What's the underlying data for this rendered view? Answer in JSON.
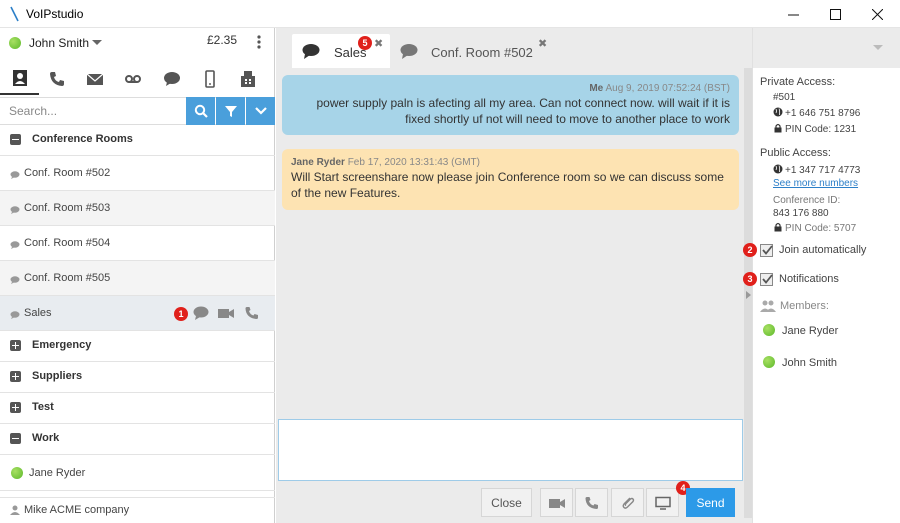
{
  "window": {
    "title": "VoIPstudio"
  },
  "user": {
    "name": "John Smith",
    "balance": "£2.35"
  },
  "search": {
    "placeholder": "Search..."
  },
  "contacts": {
    "group_conference": "Conference Rooms",
    "rooms": [
      "Conf. Room #502",
      "Conf. Room #503",
      "Conf. Room #504",
      "Conf. Room #505",
      "Sales"
    ],
    "group_emergency": "Emergency",
    "group_suppliers": "Suppliers",
    "group_test": "Test",
    "group_work": "Work",
    "work_member": "Jane Ryder",
    "footer": "Mike ACME company"
  },
  "markers": {
    "m1": "1",
    "m2": "2",
    "m3": "3",
    "m4": "4",
    "m5": "5"
  },
  "chat": {
    "tabs": [
      {
        "label": "Sales"
      },
      {
        "label": "Conf. Room #502"
      }
    ],
    "close_glyph": "✖",
    "messages": [
      {
        "sender": "Me",
        "time": "Aug 9, 2019 07:52:24 (BST)",
        "text": "power supply paln is afecting all my area. Can not connect now. will wait if it is fixed shortly uf not will need to move to another place to work"
      },
      {
        "sender": "Jane Ryder",
        "time": "Feb 17, 2020 13:31:43 (GMT)",
        "text": "Will Start screenshare now please join Conference room so we can discuss some of the new Features."
      }
    ],
    "close_label": "Close",
    "send_label": "Send"
  },
  "details": {
    "private_title": "Private Access:",
    "private_ext": "#501",
    "private_phone": "+1 646 751 8796",
    "private_pin": "PIN Code: 1231",
    "public_title": "Public Access:",
    "public_phone": "+1 347 717 4773",
    "more_numbers": "See more numbers",
    "conf_id_label": "Conference ID:",
    "conf_id": "843 176 880",
    "public_pin": "PIN Code: 5707",
    "join_auto": "Join automatically",
    "notifications": "Notifications",
    "members_label": "Members:",
    "members": [
      "Jane Ryder",
      "John Smith"
    ]
  },
  "colors": {
    "accent": "#2c9ae8",
    "marker": "#e0201b",
    "me_bubble": "#a7d4e8",
    "them_bubble": "#fde3b2",
    "status_online": "#5cb82a"
  }
}
